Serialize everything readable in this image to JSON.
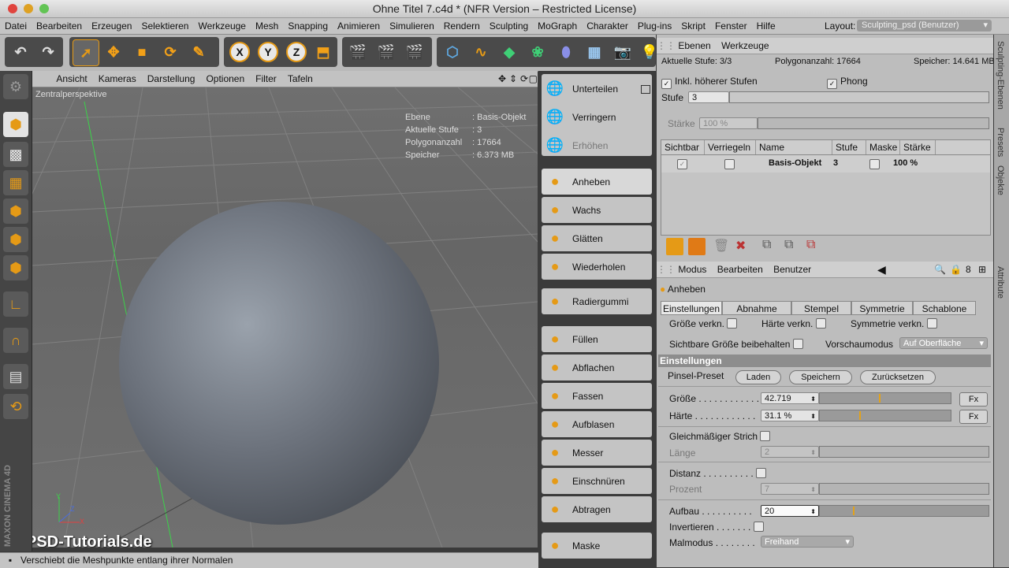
{
  "window": {
    "title": "Ohne Titel 7.c4d * (NFR Version – Restricted License)"
  },
  "menu": {
    "items": [
      "Datei",
      "Bearbeiten",
      "Erzeugen",
      "Selektieren",
      "Werkzeuge",
      "Mesh",
      "Snapping",
      "Animieren",
      "Simulieren",
      "Rendern",
      "Sculpting",
      "MoGraph",
      "Charakter",
      "Plug-ins",
      "Skript",
      "Fenster",
      "Hilfe"
    ],
    "layout_label": "Layout:",
    "layout_value": "Sculpting_psd (Benutzer)"
  },
  "toolbar": {
    "axis_x": "X",
    "axis_y": "Y",
    "axis_z": "Z"
  },
  "viewport": {
    "menu": [
      "Ansicht",
      "Kameras",
      "Darstellung",
      "Optionen",
      "Filter",
      "Tafeln"
    ],
    "camera_label": "Zentralperspektive",
    "hud": [
      {
        "k": "Ebene",
        "v": "Basis-Objekt"
      },
      {
        "k": "Aktuelle Stufe",
        "v": "3"
      },
      {
        "k": "Polygonanzahl",
        "v": "17664"
      },
      {
        "k": "Speicher",
        "v": "6.373 MB"
      }
    ],
    "axis_y": "Y",
    "axis_z": "Z",
    "axis_x": "X",
    "watermark": "PSD-Tutorials.de",
    "brand": "MAXON CINEMA 4D"
  },
  "sculpt_tools": [
    {
      "label": "Unterteilen"
    },
    {
      "label": "Verringern"
    },
    {
      "label": "Erhöhen"
    },
    {
      "label": "Anheben"
    },
    {
      "label": "Wachs"
    },
    {
      "label": "Glätten"
    },
    {
      "label": "Wiederholen"
    },
    {
      "label": "Radiergummi"
    },
    {
      "label": "Füllen"
    },
    {
      "label": "Abflachen"
    },
    {
      "label": "Fassen"
    },
    {
      "label": "Aufblasen"
    },
    {
      "label": "Messer"
    },
    {
      "label": "Einschnüren"
    },
    {
      "label": "Abtragen"
    },
    {
      "label": "Maske"
    }
  ],
  "layers_panel": {
    "tabs": [
      "Ebenen",
      "Werkzeuge"
    ],
    "current_level": "Aktuelle Stufe: 3/3",
    "poly_count": "Polygonanzahl: 17664",
    "memory": "Speicher: 14.641 MB",
    "incl_higher": "Inkl. höherer Stufen",
    "phong": "Phong",
    "stufe_label": "Stufe",
    "stufe_value": "3",
    "staerke_label": "Stärke",
    "staerke_value": "100 %",
    "columns": [
      "Sichtbar",
      "Verriegeln",
      "Name",
      "Stufe",
      "Maske",
      "Stärke"
    ],
    "row": {
      "name": "Basis-Objekt",
      "stufe": "3",
      "staerke": "100 %"
    }
  },
  "side_tabs": [
    "Sculpting-Ebenen",
    "Presets",
    "Objekte",
    "Attribute"
  ],
  "attributes": {
    "menu": [
      "Modus",
      "Bearbeiten",
      "Benutzer"
    ],
    "tool_name": "Anheben",
    "tabs": [
      "Einstellungen",
      "Abnahme",
      "Stempel",
      "Symmetrie",
      "Schablone"
    ],
    "size_link": "Größe verkn.",
    "hardness_link": "Härte verkn.",
    "symmetry_link": "Symmetrie verkn.",
    "keep_visible_size": "Sichtbare Größe beibehalten",
    "preview_mode_label": "Vorschaumodus",
    "preview_mode_value": "Auf Oberfläche",
    "section": "Einstellungen",
    "preset_label": "Pinsel-Preset",
    "load": "Laden",
    "save": "Speichern",
    "reset": "Zurücksetzen",
    "size_label": "Größe . . . . . . . . . . . .",
    "size_value": "42.719",
    "size_fraction": 0.46,
    "hardness_label": "Härte . . . . . . . . . . . .",
    "hardness_value": "31.1 %",
    "hardness_fraction": 0.311,
    "fx": "Fx",
    "even_stroke": "Gleichmäßiger Strich",
    "length_label": "Länge",
    "length_value": "2",
    "distance_label": "Distanz . . . . . . . . . .",
    "percent_label": "Prozent",
    "percent_value": "7",
    "buildup_label": "Aufbau . . . . . . . . . .",
    "buildup_value": "20",
    "buildup_fraction": 0.2,
    "invert_label": "Invertieren . . . . . . .",
    "paint_mode_label": "Malmodus . . . . . . . .",
    "paint_mode_value": "Freihand"
  },
  "status": {
    "text": "Verschiebt die Meshpunkte entlang ihrer Normalen"
  }
}
